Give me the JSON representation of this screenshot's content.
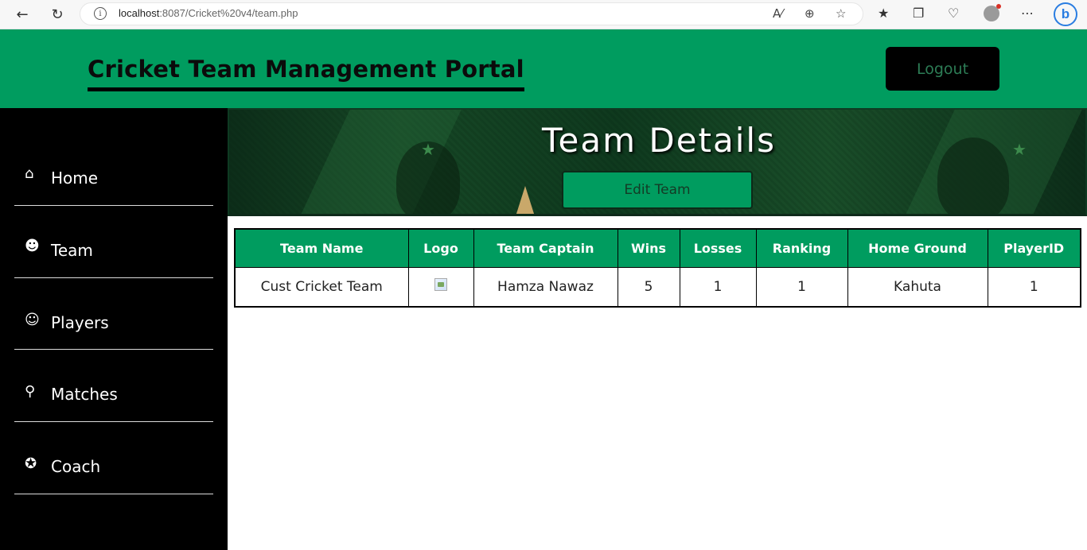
{
  "browser": {
    "url_host": "localhost",
    "url_rest": ":8087/Cricket%20v4/team.php",
    "back_icon": "back-arrow-icon",
    "refresh_icon": "refresh-icon"
  },
  "header": {
    "title": "Cricket Team Management Portal",
    "logout_label": "Logout"
  },
  "sidebar": {
    "items": [
      {
        "label": "Home",
        "icon": "home-icon"
      },
      {
        "label": "Team",
        "icon": "team-icon"
      },
      {
        "label": "Players",
        "icon": "player-icon"
      },
      {
        "label": "Matches",
        "icon": "trophy-icon"
      },
      {
        "label": "Coach",
        "icon": "coach-icon"
      }
    ]
  },
  "banner": {
    "title": "Team Details",
    "edit_label": "Edit Team"
  },
  "table": {
    "headers": [
      "Team Name",
      "Logo",
      "Team Captain",
      "Wins",
      "Losses",
      "Ranking",
      "Home Ground",
      "PlayerID"
    ],
    "rows": [
      [
        "Cust Cricket Team",
        "",
        "Hamza Nawaz",
        "5",
        "1",
        "1",
        "Kahuta",
        "1"
      ]
    ]
  },
  "colors": {
    "brand_green": "#009c5f",
    "sidebar_bg": "#000000"
  }
}
